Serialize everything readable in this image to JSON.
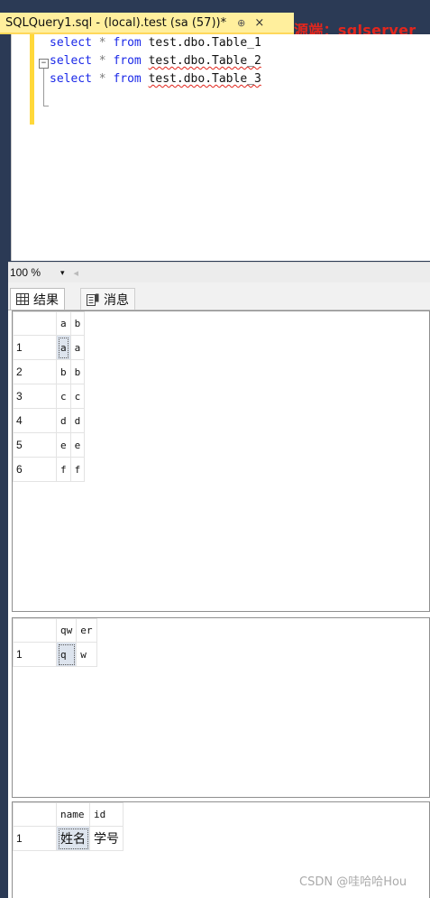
{
  "tab": {
    "title": "SQLQuery1.sql - (local).test (sa (57))*",
    "pin_glyph": "⊕",
    "close_glyph": "×"
  },
  "source_label": "源端：sqlserver",
  "editor": {
    "lines": [
      {
        "kw1": "select",
        "star": "*",
        "kw2": "from",
        "table": "test.dbo.Table_1",
        "squiggle": false
      },
      {
        "kw1": "select",
        "star": "*",
        "kw2": "from",
        "table": "test.dbo.Table_2",
        "squiggle": true
      },
      {
        "kw1": "select",
        "star": "*",
        "kw2": "from",
        "table": "test.dbo.Table_3",
        "squiggle": true
      }
    ],
    "collapse_glyph": "−"
  },
  "zoom": {
    "value": "100 %",
    "dropdown_glyph": "▾",
    "scroll_glyph": "◂"
  },
  "result_tabs": {
    "results": "结果",
    "messages": "消息"
  },
  "grids": [
    {
      "columns": [
        "a",
        "b"
      ],
      "rows": [
        [
          "1",
          "a",
          "a"
        ],
        [
          "2",
          "b",
          "b"
        ],
        [
          "3",
          "c",
          "c"
        ],
        [
          "4",
          "d",
          "d"
        ],
        [
          "5",
          "e",
          "e"
        ],
        [
          "6",
          "f",
          "f"
        ]
      ]
    },
    {
      "columns": [
        "qw",
        "er"
      ],
      "rows": [
        [
          "1",
          "q",
          "w"
        ]
      ]
    },
    {
      "columns": [
        "name",
        "id"
      ],
      "rows": [
        [
          "1",
          "姓名",
          "学号"
        ]
      ]
    }
  ],
  "watermark": "CSDN @哇哈哈Hou",
  "colors": {
    "tab_bg": "#ffef9d",
    "keyword": "#1a28e8",
    "source_label": "#e3261d"
  }
}
